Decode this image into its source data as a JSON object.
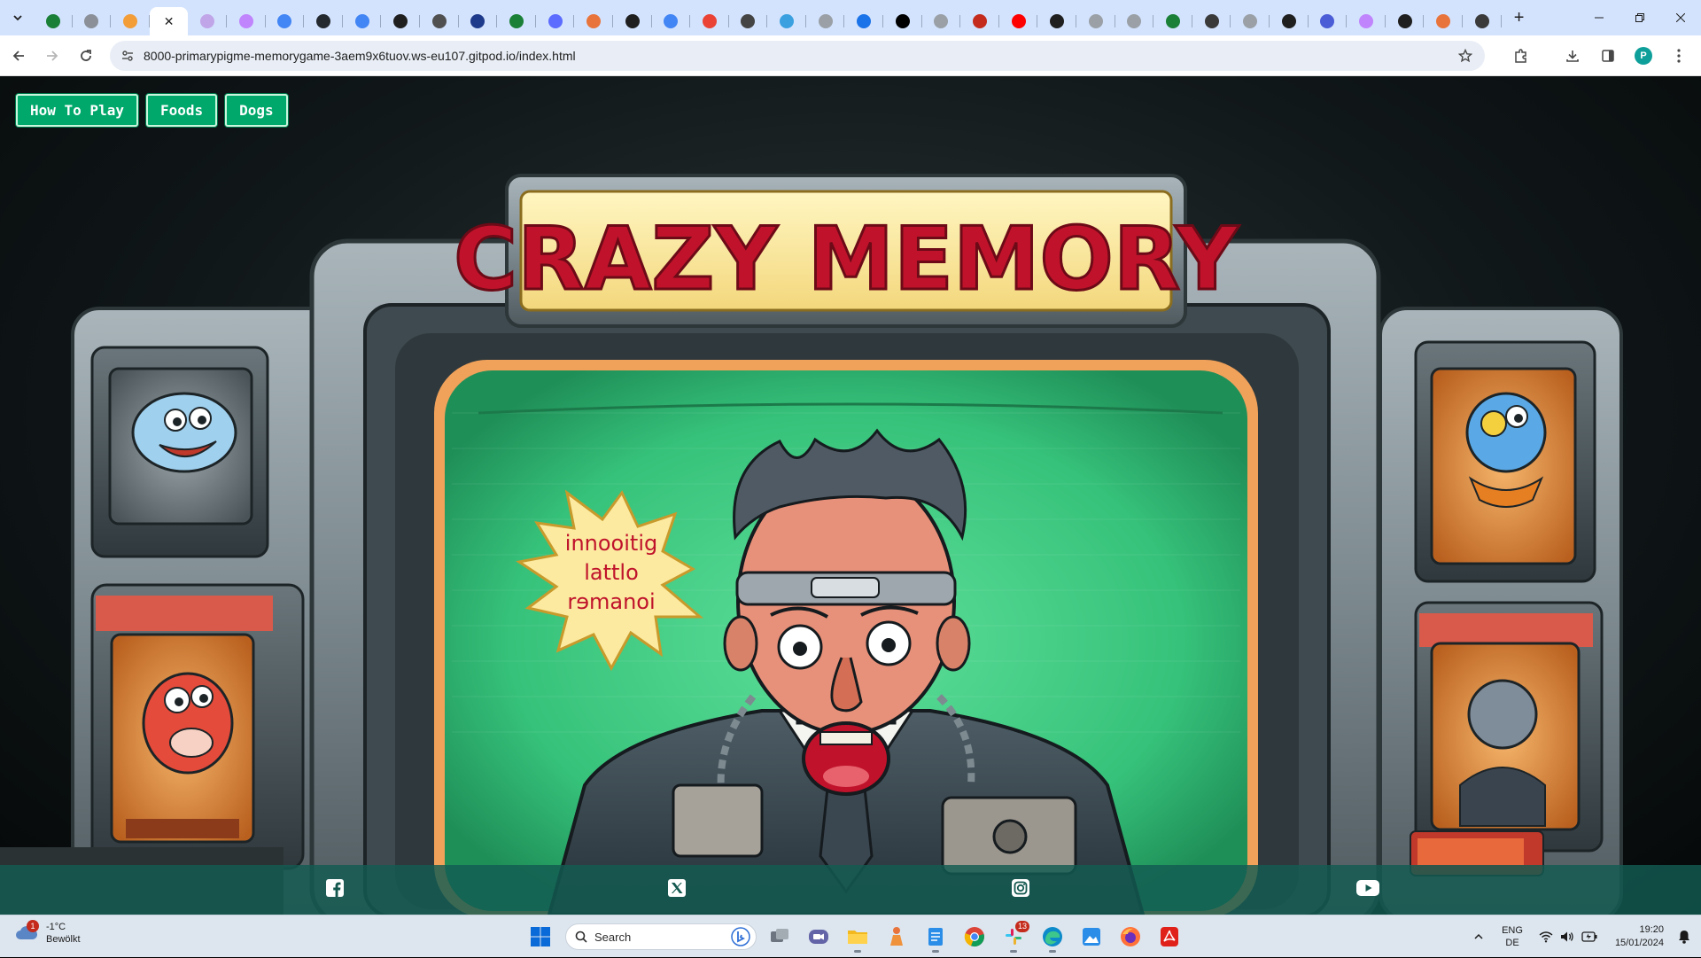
{
  "browser": {
    "tabs": [
      {
        "icon": "tab-list-icon",
        "color": "#1f1f1f"
      },
      {
        "icon": "w-icon",
        "color": "#1a7f37"
      },
      {
        "icon": "globe-icon",
        "color": "#8a8f98"
      },
      {
        "icon": "orange-logo-icon",
        "color": "#f29d38"
      },
      {
        "icon": "active-tab",
        "color": "#ffffff"
      },
      {
        "icon": "globe-icon",
        "color": "#c0a6e8"
      },
      {
        "icon": "globe-icon",
        "color": "#c084fc"
      },
      {
        "icon": "google-icon",
        "color": "#4285f4"
      },
      {
        "icon": "github-icon",
        "color": "#24292f"
      },
      {
        "icon": "google-icon",
        "color": "#4285f4"
      },
      {
        "icon": "openai-icon",
        "color": "#1f1f1f"
      },
      {
        "icon": "openai-icon",
        "color": "#505050"
      },
      {
        "icon": "b-icon",
        "color": "#1e3a8a"
      },
      {
        "icon": "w-icon",
        "color": "#1a7f37"
      },
      {
        "icon": "globe-icon",
        "color": "#5b6cff"
      },
      {
        "icon": "figure-icon",
        "color": "#e8743b"
      },
      {
        "icon": "openai-icon",
        "color": "#1f1f1f"
      },
      {
        "icon": "google-icon",
        "color": "#4285f4"
      },
      {
        "icon": "gmail-icon",
        "color": "#ea4335"
      },
      {
        "icon": "compass-icon",
        "color": "#444444"
      },
      {
        "icon": "circle-c-icon",
        "color": "#3aa0e0"
      },
      {
        "icon": "globe-icon",
        "color": "#9aa0a6"
      },
      {
        "icon": "search-icon",
        "color": "#1a73e8"
      },
      {
        "icon": "medium-icon",
        "color": "#000000"
      },
      {
        "icon": "globe-icon",
        "color": "#9aa0a6"
      },
      {
        "icon": "q-icon",
        "color": "#c42b1c"
      },
      {
        "icon": "youtube-icon",
        "color": "#ff0000"
      },
      {
        "icon": "openai-icon",
        "color": "#1f1f1f"
      },
      {
        "icon": "globe-icon",
        "color": "#9aa0a6"
      },
      {
        "icon": "globe-icon",
        "color": "#9aa0a6"
      },
      {
        "icon": "w-icon",
        "color": "#1a7f37"
      },
      {
        "icon": "openai-icon",
        "color": "#3a3a3a"
      },
      {
        "icon": "globe-icon",
        "color": "#9aa0a6"
      },
      {
        "icon": "openai-icon",
        "color": "#1f1f1f"
      },
      {
        "icon": "globe-icon",
        "color": "#4a5cd6"
      },
      {
        "icon": "globe-icon",
        "color": "#c084fc"
      },
      {
        "icon": "openai-icon",
        "color": "#1f1f1f"
      },
      {
        "icon": "globe-icon",
        "color": "#e8743b"
      },
      {
        "icon": "globe-icon",
        "color": "#3a3a3a"
      }
    ],
    "url": "8000-primarypigme-memorygame-3aem9x6tuov.ws-eu107.gitpod.io/index.html",
    "profile_initial": "P"
  },
  "page": {
    "nav": {
      "how_to_play": "How To Play",
      "foods": "Foods",
      "dogs": "Dogs"
    },
    "hero": {
      "title_sign": "CRAZY MEMORY",
      "speech_bubble": [
        "innooitig",
        "lattlo",
        "rɘmanoi"
      ]
    },
    "footer_icons": [
      "facebook-icon",
      "x-twitter-icon",
      "instagram-icon",
      "youtube-icon"
    ]
  },
  "taskbar": {
    "weather": {
      "temp": "-1°C",
      "condition": "Bewölkt",
      "badge": "1"
    },
    "search_placeholder": "Search",
    "teams_badge": "13",
    "language": {
      "top": "ENG",
      "bottom": "DE"
    },
    "clock": {
      "time": "19:20",
      "date": "15/01/2024"
    }
  }
}
